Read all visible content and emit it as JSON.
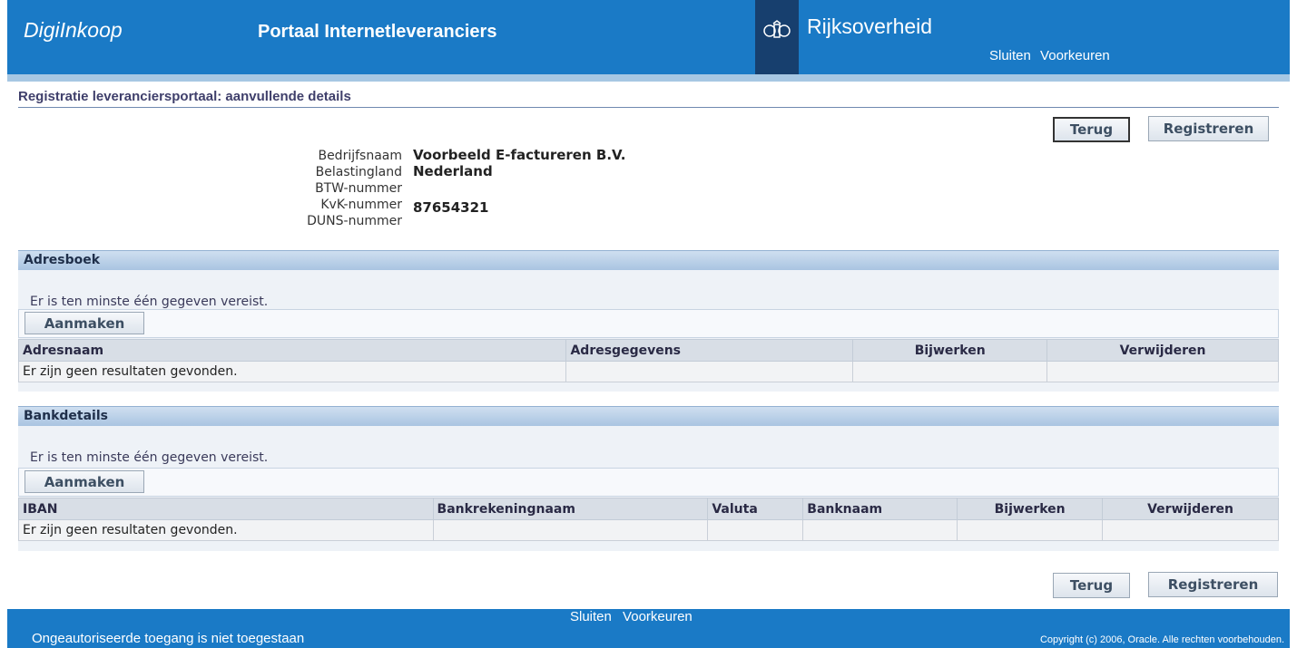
{
  "header": {
    "brand": "DigiInkoop",
    "portal_title": "Portaal Internetleveranciers",
    "gov_name": "Rijksoverheid",
    "links": [
      "Sluiten",
      "Voorkeuren"
    ]
  },
  "page": {
    "title": "Registratie leveranciersportaal: aanvullende details"
  },
  "buttons": {
    "back": "Terug",
    "register": "Registreren",
    "create": "Aanmaken"
  },
  "details": {
    "labels": [
      "Bedrijfsnaam",
      "Belastingland",
      "BTW-nummer",
      "KvK-nummer",
      "DUNS-nummer"
    ],
    "values": [
      "Voorbeeld E-factureren B.V.",
      "Nederland",
      "",
      "87654321",
      ""
    ]
  },
  "address_book": {
    "title": "Adresboek",
    "notice": "Er is ten minste één gegeven vereist.",
    "columns": [
      "Adresnaam",
      "Adresgegevens",
      "Bijwerken",
      "Verwijderen"
    ],
    "empty_message": "Er zijn geen resultaten gevonden."
  },
  "bank_details": {
    "title": "Bankdetails",
    "notice": "Er is ten minste één gegeven vereist.",
    "columns": [
      "IBAN",
      "Bankrekeningnaam",
      "Valuta",
      "Banknaam",
      "Bijwerken",
      "Verwijderen"
    ],
    "empty_message": "Er zijn geen resultaten gevonden."
  },
  "footer": {
    "links": [
      "Sluiten",
      "Voorkeuren"
    ],
    "notice": "Ongeautoriseerde toegang is niet toegestaan",
    "copyright": "Copyright (c) 2006, Oracle. Alle rechten voorbehouden."
  },
  "colors": {
    "header_blue": "#1a7ac6",
    "crest_block": "#173f6e",
    "section_header": "#a9c4e1"
  }
}
